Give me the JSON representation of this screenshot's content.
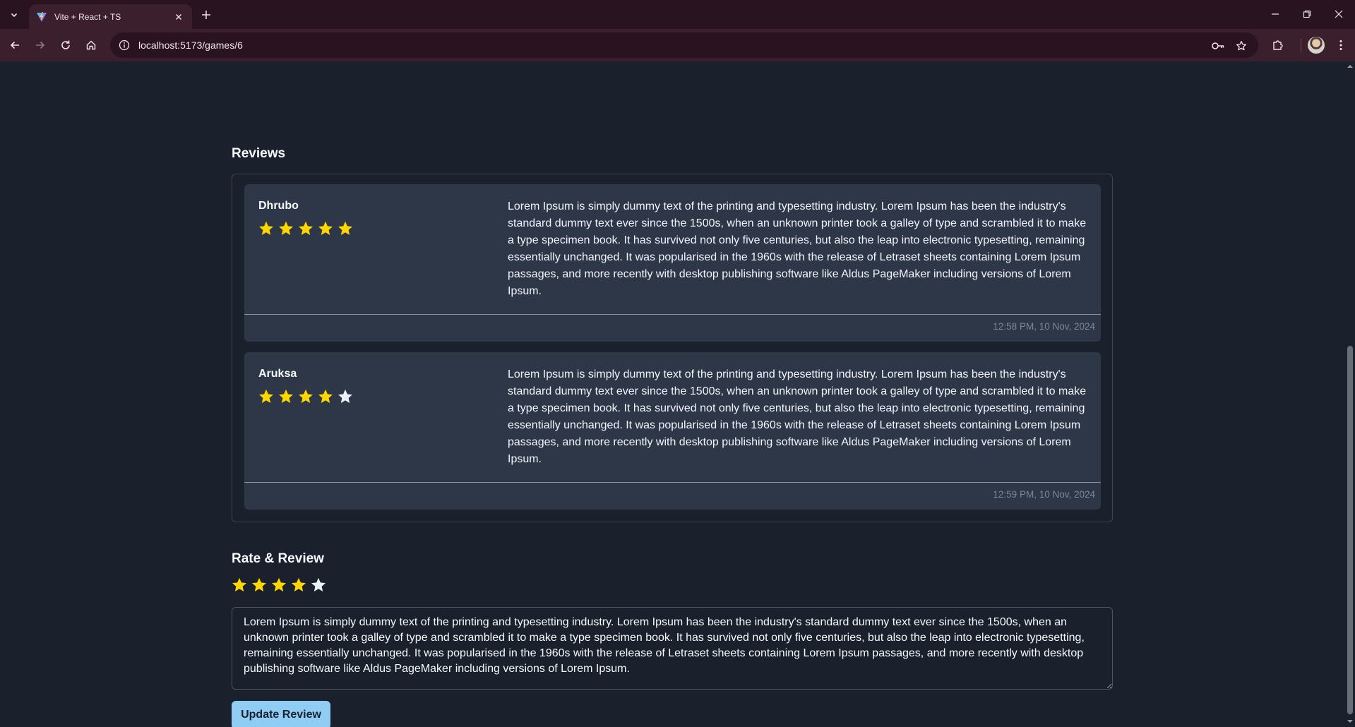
{
  "browser": {
    "tab_title": "Vite + React + TS",
    "url": "localhost:5173/games/6"
  },
  "reviews_section": {
    "title": "Reviews",
    "items": [
      {
        "author": "Dhrubo",
        "rating": 5,
        "text": "Lorem Ipsum is simply dummy text of the printing and typesetting industry. Lorem Ipsum has been the industry's standard dummy text ever since the 1500s, when an unknown printer took a galley of type and scrambled it to make a type specimen book. It has survived not only five centuries, but also the leap into electronic typesetting, remaining essentially unchanged. It was popularised in the 1960s with the release of Letraset sheets containing Lorem Ipsum passages, and more recently with desktop publishing software like Aldus PageMaker including versions of Lorem Ipsum.",
        "timestamp": "12:58 PM, 10 Nov, 2024"
      },
      {
        "author": "Aruksa",
        "rating": 4,
        "text": "Lorem Ipsum is simply dummy text of the printing and typesetting industry. Lorem Ipsum has been the industry's standard dummy text ever since the 1500s, when an unknown printer took a galley of type and scrambled it to make a type specimen book. It has survived not only five centuries, but also the leap into electronic typesetting, remaining essentially unchanged. It was popularised in the 1960s with the release of Letraset sheets containing Lorem Ipsum passages, and more recently with desktop publishing software like Aldus PageMaker including versions of Lorem Ipsum.",
        "timestamp": "12:59 PM, 10 Nov, 2024"
      }
    ]
  },
  "rate_section": {
    "title": "Rate & Review",
    "rating": 4,
    "review_text": "Lorem Ipsum is simply dummy text of the printing and typesetting industry. Lorem Ipsum has been the industry's standard dummy text ever since the 1500s, when an unknown printer took a galley of type and scrambled it to make a type specimen book. It has survived not only five centuries, but also the leap into electronic typesetting, remaining essentially unchanged. It was popularised in the 1960s with the release of Letraset sheets containing Lorem Ipsum passages, and more recently with desktop publishing software like Aldus PageMaker including versions of Lorem Ipsum.",
    "submit_label": "Update Review"
  },
  "colors": {
    "star_filled": "#ffd700",
    "star_empty": "#edf2f7",
    "button": "#90cdf4",
    "background": "#1a202c",
    "card": "#2d3748"
  },
  "icons": {
    "star": "star-icon",
    "back": "arrow-left-icon",
    "forward": "arrow-right-icon",
    "reload": "reload-icon",
    "home": "home-icon",
    "site_info": "info-icon",
    "password": "key-icon",
    "bookmark": "star-outline-icon",
    "extensions": "puzzle-icon",
    "menu": "kebab-menu-icon"
  }
}
